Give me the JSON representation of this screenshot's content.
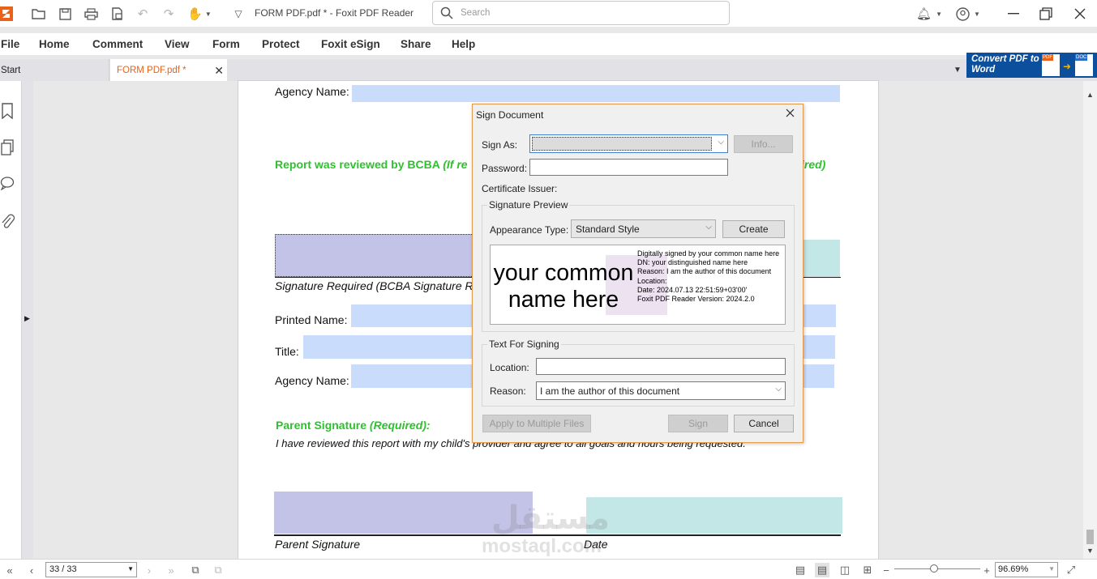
{
  "window": {
    "title": "FORM PDF.pdf * - Foxit PDF Reader"
  },
  "search": {
    "placeholder": "Search"
  },
  "menu": [
    "File",
    "Home",
    "Comment",
    "View",
    "Form",
    "Protect",
    "Foxit eSign",
    "Share",
    "Help"
  ],
  "tabs": {
    "start": "Start",
    "active": "FORM PDF.pdf *"
  },
  "ad": {
    "text": "Convert PDF to Word",
    "pdf_label": "PDF",
    "doc_label": "DOC"
  },
  "document": {
    "agency_label_top": "Agency Name:",
    "reviewed_text": "Report was reviewed by BCBA",
    "reviewed_italic": "(If re",
    "required_tail": "ired)",
    "sig_required": "Signature Required (BCBA Signature R",
    "printed_name": "Printed Name:",
    "title_label": "Title:",
    "agency_label": "Agency Name:",
    "parent_sig_title": "Parent Signature",
    "parent_sig_req": "(Required):",
    "parent_statement": "I have reviewed this report with my child's provider and agree to all goals and hours being requested.",
    "parent_sig_caption": "Parent Signature",
    "date_caption": "Date"
  },
  "dialog": {
    "title": "Sign Document",
    "sign_as_label": "Sign As:",
    "info_button": "Info...",
    "password_label": "Password:",
    "cert_issuer_label": "Certificate Issuer:",
    "preview_group": "Signature Preview",
    "appearance_label": "Appearance Type:",
    "appearance_value": "Standard Style",
    "create_button": "Create",
    "preview_big_1": "your common",
    "preview_big_2": "name here",
    "preview_lines": [
      "Digitally signed by your common name here",
      "DN: your distinguished name here",
      "Reason: I am the author of this document",
      "Location:",
      "Date: 2024.07.13 22:51:59+03'00'",
      "Foxit PDF Reader Version: 2024.2.0"
    ],
    "text_group": "Text For Signing",
    "location_label": "Location:",
    "reason_label": "Reason:",
    "reason_value": "I am the author of this document",
    "apply_multi_button": "Apply to Multiple Files",
    "sign_button": "Sign",
    "cancel_button": "Cancel"
  },
  "status": {
    "page": "33 / 33",
    "zoom": "96.69%"
  },
  "watermark": {
    "arabic": "مستقل",
    "latin": "mostaql.com"
  },
  "colors": {
    "accent": "#e8621a",
    "field": "#c9dcfc",
    "sig_field": "#c3c3e8",
    "date_field": "#c3e6e6",
    "green": "#2ec12e",
    "ad": "#0c4f9c"
  }
}
